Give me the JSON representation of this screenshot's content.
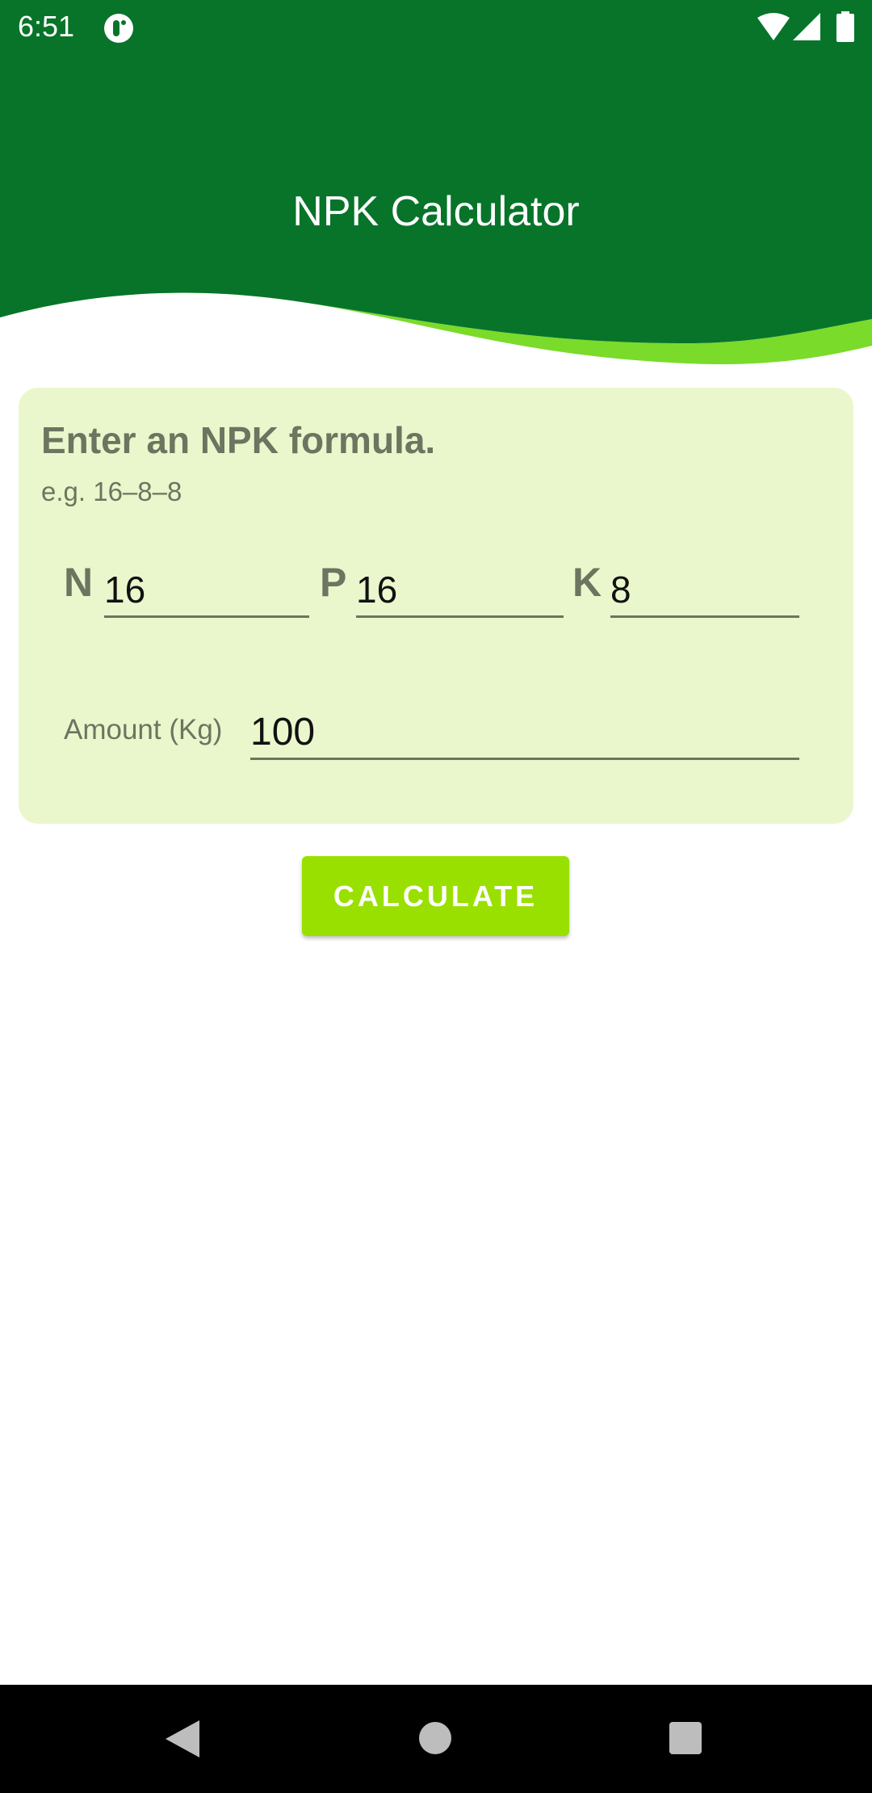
{
  "status_bar": {
    "time": "6:51",
    "icons": [
      "app-notification-icon",
      "wifi-icon",
      "signal-icon",
      "battery-icon"
    ]
  },
  "header": {
    "title": "NPK Calculator"
  },
  "colors": {
    "header_green": "#07742a",
    "wave_lime": "#7adb2a",
    "card_bg": "#eaf7cc",
    "button": "#99e000"
  },
  "form": {
    "prompt": "Enter an NPK formula.",
    "example": "e.g. 16–8–8",
    "n_label": "N",
    "n_value": "16",
    "p_label": "P",
    "p_value": "16",
    "k_label": "K",
    "k_value": "8",
    "amount_label": "Amount (Kg)",
    "amount_value": "100"
  },
  "calculate_label": "CALCULATE",
  "nav_bar": {
    "icons": [
      "back-icon",
      "home-icon",
      "recents-icon"
    ]
  }
}
